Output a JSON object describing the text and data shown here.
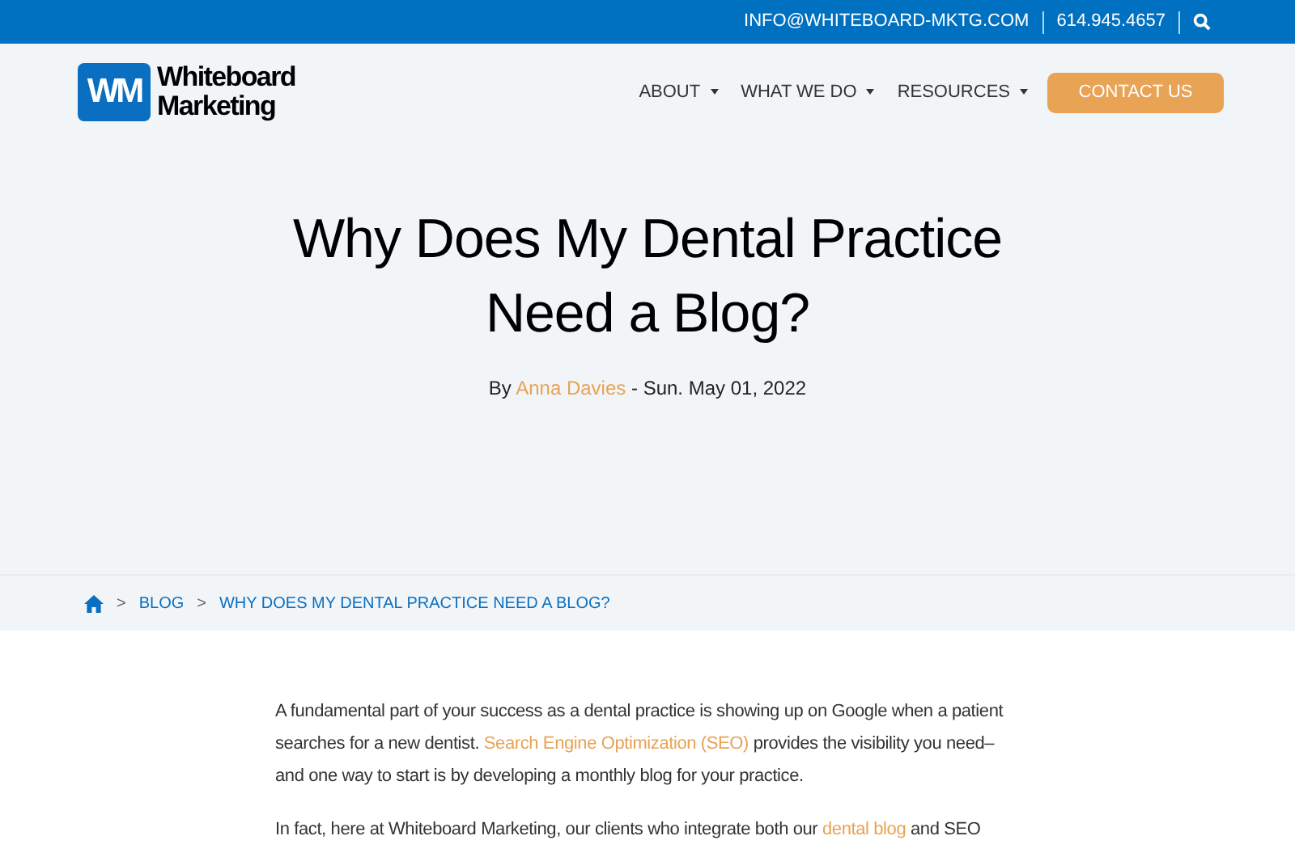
{
  "top_bar": {
    "email": "INFO@WHITEBOARD-MKTG.COM",
    "phone": "614.945.4657"
  },
  "logo": {
    "mark": "WM",
    "line_1": "Whiteboard",
    "line_2": "Marketing"
  },
  "nav": [
    "ABOUT",
    "WHAT WE DO",
    "RESOURCES"
  ],
  "cta_button": "CONTACT US",
  "title_lines": [
    "Why Does My Dental Practice",
    "Need a Blog?"
  ],
  "byline": {
    "prefix": "By",
    "author": "Anna Davies",
    "date": "- Sun. May 01, 2022"
  },
  "breadcrumb": [
    {
      "separator": ">",
      "label": "BLOG"
    },
    {
      "separator": ">",
      "label": "WHY DOES MY DENTAL PRACTICE NEED A BLOG?"
    }
  ],
  "paragraphs": [
    {
      "before": "A fundamental part of your success as a dental practice is showing up on Google when a patient searches for a new dentist. ",
      "link": "Search Engine Optimization (SEO)",
      "after": " provides the visibility you need–and one way to start is by developing a monthly blog for your practice."
    },
    {
      "before": "In fact, here at Whiteboard Marketing, our clients who integrate both our ",
      "link": "dental blog",
      "after": " and SEO"
    }
  ]
}
